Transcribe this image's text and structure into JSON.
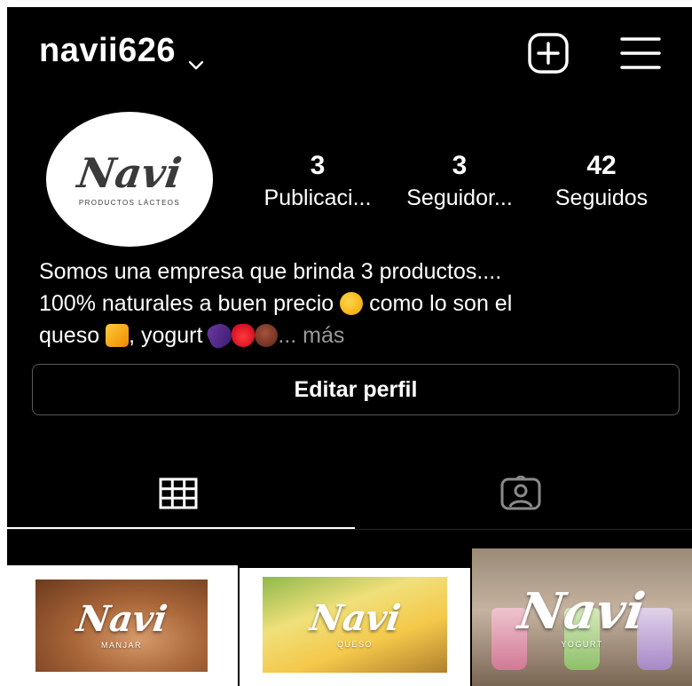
{
  "header": {
    "username": "navii626",
    "icons": {
      "account_switch": "chevron-down-icon",
      "new_post": "plus-square-icon",
      "menu": "hamburger-menu-icon"
    }
  },
  "profile": {
    "avatar": {
      "brand": "Navi",
      "tagline": "PRODUCTOS LÁCTEOS"
    },
    "stats": [
      {
        "value": "3",
        "label": "Publicaci..."
      },
      {
        "value": "3",
        "label": "Seguidor..."
      },
      {
        "value": "42",
        "label": "Seguidos"
      }
    ],
    "bio": {
      "line1": "Somos una empresa que brinda 3 productos....",
      "line2_before": "100% naturales a buen precio ",
      "line2_after": " como lo son el",
      "line3_before": "queso ",
      "line3_mid": ", yogurt ",
      "more": "... más"
    },
    "edit_button_label": "Editar perfil"
  },
  "tabs": [
    {
      "id": "posts",
      "icon": "grid-icon",
      "active": true
    },
    {
      "id": "tagged",
      "icon": "tagged-person-icon",
      "active": false
    }
  ],
  "posts": [
    {
      "brand": "Navi",
      "subtitle": "MANJAR"
    },
    {
      "brand": "Navi",
      "subtitle": "QUESO"
    },
    {
      "brand": "Navi",
      "subtitle": "YOGURT"
    }
  ],
  "colors": {
    "background": "#000000",
    "text": "#ffffff",
    "muted": "#9a9a9a",
    "border": "#5a5a5a"
  }
}
